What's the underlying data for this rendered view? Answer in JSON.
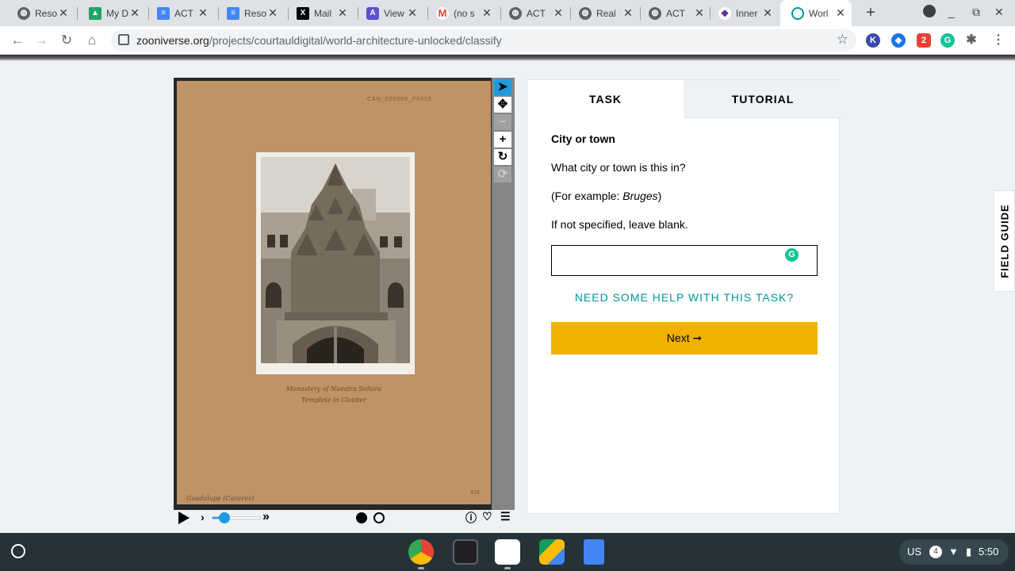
{
  "browser": {
    "tabs": [
      {
        "label": "Reso",
        "icon": "globe-icon",
        "color": "#5f6368"
      },
      {
        "label": "My D",
        "icon": "google-drive-icon",
        "color": "#1fa463"
      },
      {
        "label": "ACT",
        "icon": "google-docs-icon",
        "color": "#4285f4"
      },
      {
        "label": "Reso",
        "icon": "google-docs-icon",
        "color": "#4285f4"
      },
      {
        "label": "Mail",
        "icon": "x-mail-icon",
        "color": "#000000"
      },
      {
        "label": "View",
        "icon": "pdf-icon",
        "color": "#5b4fd6"
      },
      {
        "label": "(no s",
        "icon": "gmail-icon",
        "color": "#ea4335"
      },
      {
        "label": "ACT",
        "icon": "globe-icon",
        "color": "#5f6368"
      },
      {
        "label": "Real",
        "icon": "globe-icon",
        "color": "#5f6368"
      },
      {
        "label": "ACT",
        "icon": "globe-icon",
        "color": "#5f6368"
      },
      {
        "label": "Inner",
        "icon": "inner-icon",
        "color": "#6a2c91"
      },
      {
        "label": "Worl",
        "icon": "zooniverse-icon",
        "color": "#00979d"
      }
    ],
    "url_host": "zooniverse.org",
    "url_path": "/projects/courtauldigital/world-architecture-unlocked/classify",
    "extensions": [
      {
        "name": "k-extension-icon",
        "text": "K",
        "color": "#3949ab"
      },
      {
        "name": "shield-extension-icon",
        "text": "◈",
        "color": "#1a73e8"
      },
      {
        "name": "badge-extension-icon",
        "text": "2",
        "color": "#e94235"
      },
      {
        "name": "grammarly-extension-icon",
        "text": "G",
        "color": "#15c39a"
      },
      {
        "name": "puzzle-extension-icon",
        "text": "✱",
        "color": "#5f6368"
      }
    ]
  },
  "viewer": {
    "catalog_number": "CAN_000000_F0416",
    "caption_line1": "Monastery of Nuestra Señora",
    "caption_line2": "Templete in Cloister",
    "location_label": "Guadalupe (Caceres)",
    "page_number": "416",
    "speed_fraction": 0.25,
    "frames": [
      {
        "state": "filled"
      },
      {
        "state": "empty"
      }
    ]
  },
  "task": {
    "tab_task": "TASK",
    "tab_tutorial": "TUTORIAL",
    "title": "City or town",
    "question": "What city or town is this in?",
    "example_prefix": "(For example: ",
    "example_value": "Bruges",
    "example_suffix": ")",
    "instruction": "If not specified, leave blank.",
    "answer_value": "",
    "help_link": "NEED SOME HELP WITH THIS TASK?",
    "next_label": "Next ➞"
  },
  "field_guide_label": "FIELD GUIDE",
  "shelf": {
    "keyboard": "US",
    "notifications": "4",
    "time": "5:50"
  },
  "colors": {
    "accent_teal": "#00979d",
    "next_button": "#f0b200",
    "tool_active": "#1f9be0"
  }
}
